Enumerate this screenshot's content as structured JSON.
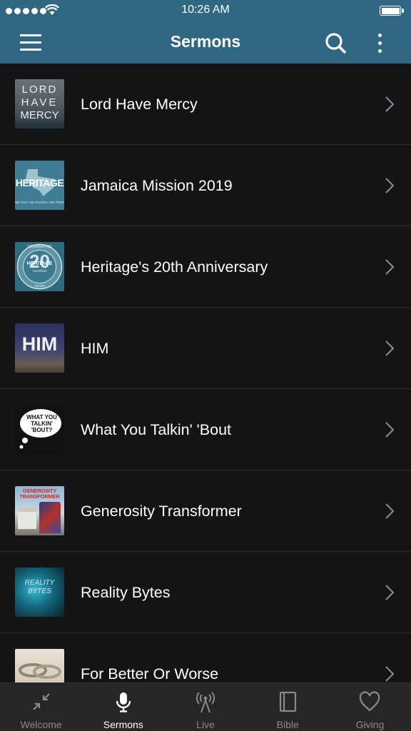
{
  "status_bar": {
    "time": "10:26 AM",
    "signal_bars": 5,
    "battery_level": 1.0
  },
  "nav": {
    "title": "Sermons",
    "left_icon": "hamburger-menu-icon",
    "right_icons": [
      "search-icon",
      "more-vertical-icon"
    ]
  },
  "sermons": [
    {
      "title": "Lord Have Mercy",
      "thumb_text": [
        "LORD",
        "HAVE",
        "MERCY"
      ]
    },
    {
      "title": "Jamaica Mission 2019",
      "thumb_text": [
        "HERITAGE",
        "BE YOU • BE KNOWN • BE FREE"
      ]
    },
    {
      "title": "Heritage's 20th Anniversary",
      "thumb_text": [
        "CELEBRATING",
        "20",
        "HERITAGE",
        "CHURCH",
        "YEARS"
      ]
    },
    {
      "title": "HIM",
      "thumb_text": [
        "HIM"
      ]
    },
    {
      "title": "What You Talkin' 'Bout",
      "thumb_text": [
        "WHAT YOU",
        "TALKIN'",
        "'BOUT?"
      ]
    },
    {
      "title": "Generosity Transformer",
      "thumb_text": [
        "GENEROSITY",
        "TRANSFORMER"
      ]
    },
    {
      "title": "Reality Bytes",
      "thumb_text": [
        "REALITY",
        "BYTES"
      ]
    },
    {
      "title": "For Better Or Worse",
      "thumb_text": []
    }
  ],
  "tabs": [
    {
      "label": "Welcome",
      "icon": "collapse-arrows-icon",
      "active": false
    },
    {
      "label": "Sermons",
      "icon": "microphone-icon",
      "active": true
    },
    {
      "label": "Live",
      "icon": "broadcast-tower-icon",
      "active": false
    },
    {
      "label": "Bible",
      "icon": "book-icon",
      "active": false
    },
    {
      "label": "Giving",
      "icon": "heart-icon",
      "active": false
    }
  ],
  "colors": {
    "header": "#2f6880",
    "background": "#141416",
    "tab_bar": "#262628",
    "tab_inactive": "#8a8a8c",
    "tab_active": "#ffffff"
  }
}
